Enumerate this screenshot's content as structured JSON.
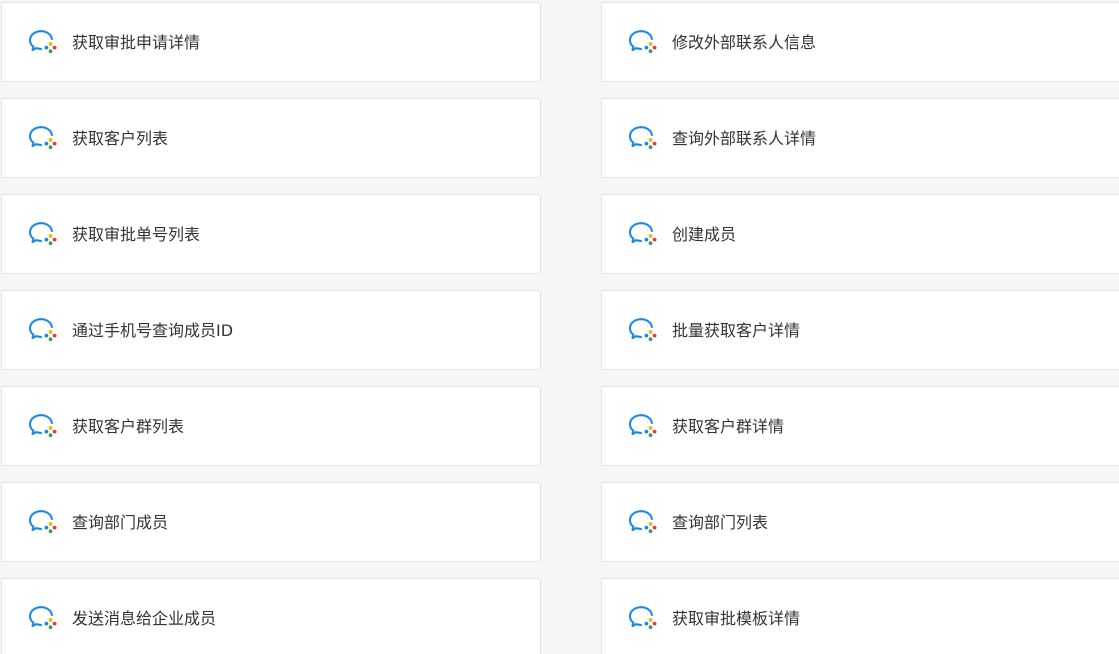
{
  "colors": {
    "background": "#f5f6f8",
    "card": "#ffffff",
    "border": "#e3e5e8",
    "text": "#333333",
    "icon_blue": "#1e88e5"
  },
  "icon": "wecom-chat-icon",
  "items": [
    {
      "label": "获取审批申请详情"
    },
    {
      "label": "修改外部联系人信息"
    },
    {
      "label": "获取客户列表"
    },
    {
      "label": "查询外部联系人详情"
    },
    {
      "label": "获取审批单号列表"
    },
    {
      "label": "创建成员"
    },
    {
      "label": "通过手机号查询成员ID"
    },
    {
      "label": "批量获取客户详情"
    },
    {
      "label": "获取客户群列表"
    },
    {
      "label": "获取客户群详情"
    },
    {
      "label": "查询部门成员"
    },
    {
      "label": "查询部门列表"
    },
    {
      "label": "发送消息给企业成员"
    },
    {
      "label": "获取审批模板详情"
    }
  ]
}
